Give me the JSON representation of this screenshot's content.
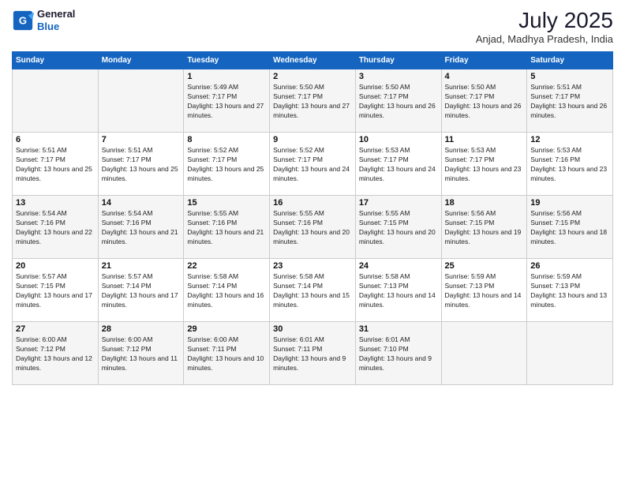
{
  "logo": {
    "line1": "General",
    "line2": "Blue"
  },
  "title": {
    "month_year": "July 2025",
    "location": "Anjad, Madhya Pradesh, India"
  },
  "weekdays": [
    "Sunday",
    "Monday",
    "Tuesday",
    "Wednesday",
    "Thursday",
    "Friday",
    "Saturday"
  ],
  "weeks": [
    [
      {
        "day": "",
        "sunrise": "",
        "sunset": "",
        "daylight": ""
      },
      {
        "day": "",
        "sunrise": "",
        "sunset": "",
        "daylight": ""
      },
      {
        "day": "1",
        "sunrise": "Sunrise: 5:49 AM",
        "sunset": "Sunset: 7:17 PM",
        "daylight": "Daylight: 13 hours and 27 minutes."
      },
      {
        "day": "2",
        "sunrise": "Sunrise: 5:50 AM",
        "sunset": "Sunset: 7:17 PM",
        "daylight": "Daylight: 13 hours and 27 minutes."
      },
      {
        "day": "3",
        "sunrise": "Sunrise: 5:50 AM",
        "sunset": "Sunset: 7:17 PM",
        "daylight": "Daylight: 13 hours and 26 minutes."
      },
      {
        "day": "4",
        "sunrise": "Sunrise: 5:50 AM",
        "sunset": "Sunset: 7:17 PM",
        "daylight": "Daylight: 13 hours and 26 minutes."
      },
      {
        "day": "5",
        "sunrise": "Sunrise: 5:51 AM",
        "sunset": "Sunset: 7:17 PM",
        "daylight": "Daylight: 13 hours and 26 minutes."
      }
    ],
    [
      {
        "day": "6",
        "sunrise": "Sunrise: 5:51 AM",
        "sunset": "Sunset: 7:17 PM",
        "daylight": "Daylight: 13 hours and 25 minutes."
      },
      {
        "day": "7",
        "sunrise": "Sunrise: 5:51 AM",
        "sunset": "Sunset: 7:17 PM",
        "daylight": "Daylight: 13 hours and 25 minutes."
      },
      {
        "day": "8",
        "sunrise": "Sunrise: 5:52 AM",
        "sunset": "Sunset: 7:17 PM",
        "daylight": "Daylight: 13 hours and 25 minutes."
      },
      {
        "day": "9",
        "sunrise": "Sunrise: 5:52 AM",
        "sunset": "Sunset: 7:17 PM",
        "daylight": "Daylight: 13 hours and 24 minutes."
      },
      {
        "day": "10",
        "sunrise": "Sunrise: 5:53 AM",
        "sunset": "Sunset: 7:17 PM",
        "daylight": "Daylight: 13 hours and 24 minutes."
      },
      {
        "day": "11",
        "sunrise": "Sunrise: 5:53 AM",
        "sunset": "Sunset: 7:17 PM",
        "daylight": "Daylight: 13 hours and 23 minutes."
      },
      {
        "day": "12",
        "sunrise": "Sunrise: 5:53 AM",
        "sunset": "Sunset: 7:16 PM",
        "daylight": "Daylight: 13 hours and 23 minutes."
      }
    ],
    [
      {
        "day": "13",
        "sunrise": "Sunrise: 5:54 AM",
        "sunset": "Sunset: 7:16 PM",
        "daylight": "Daylight: 13 hours and 22 minutes."
      },
      {
        "day": "14",
        "sunrise": "Sunrise: 5:54 AM",
        "sunset": "Sunset: 7:16 PM",
        "daylight": "Daylight: 13 hours and 21 minutes."
      },
      {
        "day": "15",
        "sunrise": "Sunrise: 5:55 AM",
        "sunset": "Sunset: 7:16 PM",
        "daylight": "Daylight: 13 hours and 21 minutes."
      },
      {
        "day": "16",
        "sunrise": "Sunrise: 5:55 AM",
        "sunset": "Sunset: 7:16 PM",
        "daylight": "Daylight: 13 hours and 20 minutes."
      },
      {
        "day": "17",
        "sunrise": "Sunrise: 5:55 AM",
        "sunset": "Sunset: 7:15 PM",
        "daylight": "Daylight: 13 hours and 20 minutes."
      },
      {
        "day": "18",
        "sunrise": "Sunrise: 5:56 AM",
        "sunset": "Sunset: 7:15 PM",
        "daylight": "Daylight: 13 hours and 19 minutes."
      },
      {
        "day": "19",
        "sunrise": "Sunrise: 5:56 AM",
        "sunset": "Sunset: 7:15 PM",
        "daylight": "Daylight: 13 hours and 18 minutes."
      }
    ],
    [
      {
        "day": "20",
        "sunrise": "Sunrise: 5:57 AM",
        "sunset": "Sunset: 7:15 PM",
        "daylight": "Daylight: 13 hours and 17 minutes."
      },
      {
        "day": "21",
        "sunrise": "Sunrise: 5:57 AM",
        "sunset": "Sunset: 7:14 PM",
        "daylight": "Daylight: 13 hours and 17 minutes."
      },
      {
        "day": "22",
        "sunrise": "Sunrise: 5:58 AM",
        "sunset": "Sunset: 7:14 PM",
        "daylight": "Daylight: 13 hours and 16 minutes."
      },
      {
        "day": "23",
        "sunrise": "Sunrise: 5:58 AM",
        "sunset": "Sunset: 7:14 PM",
        "daylight": "Daylight: 13 hours and 15 minutes."
      },
      {
        "day": "24",
        "sunrise": "Sunrise: 5:58 AM",
        "sunset": "Sunset: 7:13 PM",
        "daylight": "Daylight: 13 hours and 14 minutes."
      },
      {
        "day": "25",
        "sunrise": "Sunrise: 5:59 AM",
        "sunset": "Sunset: 7:13 PM",
        "daylight": "Daylight: 13 hours and 14 minutes."
      },
      {
        "day": "26",
        "sunrise": "Sunrise: 5:59 AM",
        "sunset": "Sunset: 7:13 PM",
        "daylight": "Daylight: 13 hours and 13 minutes."
      }
    ],
    [
      {
        "day": "27",
        "sunrise": "Sunrise: 6:00 AM",
        "sunset": "Sunset: 7:12 PM",
        "daylight": "Daylight: 13 hours and 12 minutes."
      },
      {
        "day": "28",
        "sunrise": "Sunrise: 6:00 AM",
        "sunset": "Sunset: 7:12 PM",
        "daylight": "Daylight: 13 hours and 11 minutes."
      },
      {
        "day": "29",
        "sunrise": "Sunrise: 6:00 AM",
        "sunset": "Sunset: 7:11 PM",
        "daylight": "Daylight: 13 hours and 10 minutes."
      },
      {
        "day": "30",
        "sunrise": "Sunrise: 6:01 AM",
        "sunset": "Sunset: 7:11 PM",
        "daylight": "Daylight: 13 hours and 9 minutes."
      },
      {
        "day": "31",
        "sunrise": "Sunrise: 6:01 AM",
        "sunset": "Sunset: 7:10 PM",
        "daylight": "Daylight: 13 hours and 9 minutes."
      },
      {
        "day": "",
        "sunrise": "",
        "sunset": "",
        "daylight": ""
      },
      {
        "day": "",
        "sunrise": "",
        "sunset": "",
        "daylight": ""
      }
    ]
  ]
}
